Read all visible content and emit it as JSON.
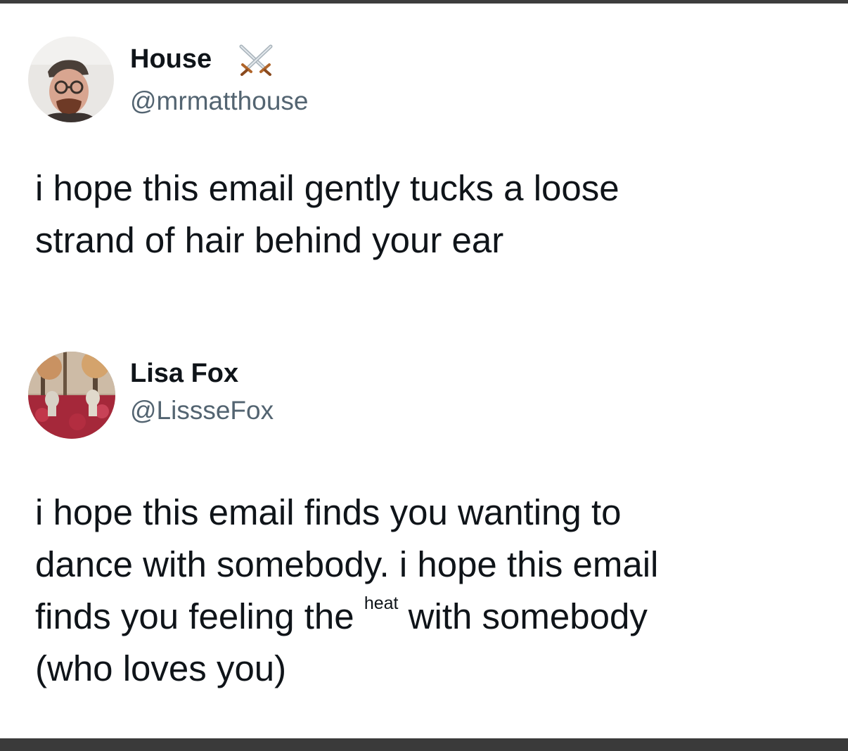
{
  "tweet1": {
    "display_name": "House",
    "badge_icon": "crossed-swords-icon",
    "handle": "@mrmatthouse",
    "text_lines": [
      "i hope this email gently tucks a loose",
      "strand of hair behind your ear"
    ]
  },
  "tweet2": {
    "display_name": "Lisa Fox",
    "handle": "@LissseFox",
    "text_line1": "i hope this email finds you wanting to",
    "text_line2": "dance with somebody. i hope this email",
    "text_line3_start": "finds you feeling the ",
    "text_line3_small": "heat",
    "text_line3_end": " with somebody",
    "text_line4": "(who loves you)"
  },
  "colors": {
    "text": "#0f1419",
    "handle": "#536471",
    "bars": "#3a3a3a"
  }
}
